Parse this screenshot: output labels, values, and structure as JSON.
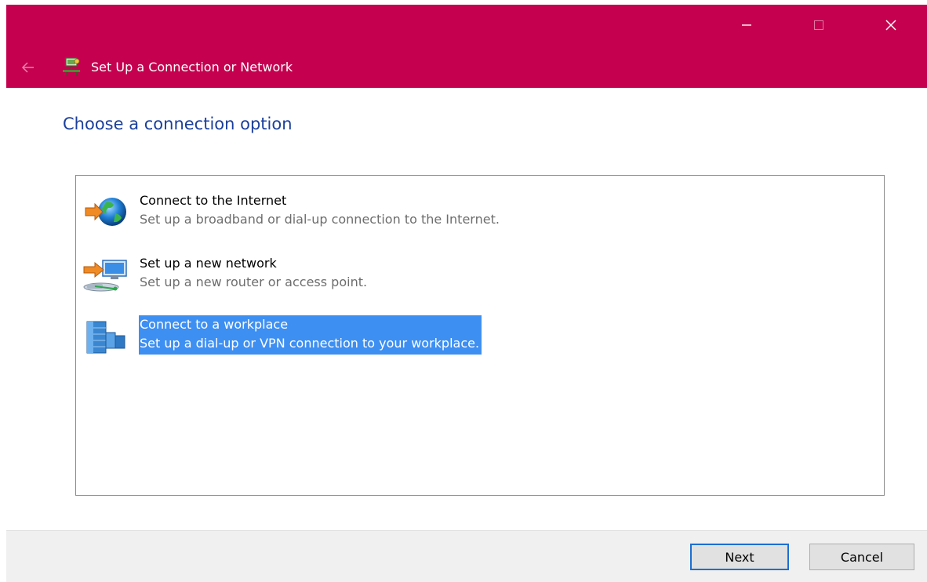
{
  "window": {
    "title": "Set Up a Connection or Network",
    "accent_color": "#c4004f"
  },
  "controls": {
    "minimize_icon": "minimize-icon",
    "maximize_icon": "maximize-icon",
    "close_icon": "close-icon",
    "back_icon": "back-arrow-icon"
  },
  "main": {
    "heading": "Choose a connection option",
    "options": [
      {
        "title": "Connect to the Internet",
        "description": "Set up a broadband or dial-up connection to the Internet.",
        "icon": "globe-icon",
        "selected": false
      },
      {
        "title": "Set up a new network",
        "description": "Set up a new router or access point.",
        "icon": "router-icon",
        "selected": false
      },
      {
        "title": "Connect to a workplace",
        "description": "Set up a dial-up or VPN connection to your workplace.",
        "icon": "workplace-icon",
        "selected": true
      }
    ]
  },
  "footer": {
    "next_label": "Next",
    "cancel_label": "Cancel"
  }
}
